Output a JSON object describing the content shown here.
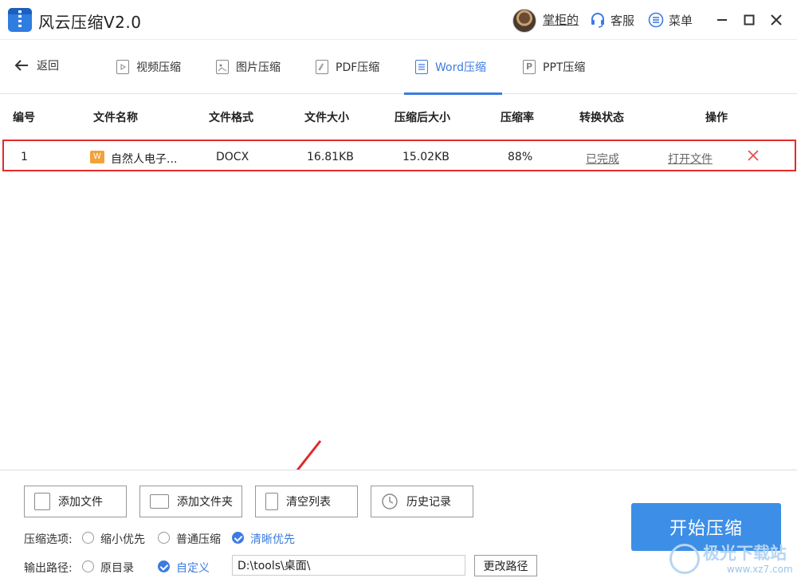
{
  "app": {
    "title": "风云压缩V2.0"
  },
  "header": {
    "user_name": "掌柜的",
    "service_label": "客服",
    "menu_label": "菜单"
  },
  "nav": {
    "back_label": "返回",
    "tabs": [
      {
        "label": "视频压缩"
      },
      {
        "label": "图片压缩"
      },
      {
        "label": "PDF压缩"
      },
      {
        "label": "Word压缩",
        "active": true
      },
      {
        "label": "PPT压缩"
      }
    ]
  },
  "table": {
    "columns": [
      "编号",
      "文件名称",
      "文件格式",
      "文件大小",
      "压缩后大小",
      "压缩率",
      "转换状态",
      "操作"
    ],
    "rows": [
      {
        "index": "1",
        "file_type_badge": "W",
        "name": "自然人电子...",
        "format": "DOCX",
        "size": "16.81KB",
        "compressed_size": "15.02KB",
        "ratio": "88%",
        "status": "已完成",
        "action": "打开文件"
      }
    ]
  },
  "toolbar": {
    "add_file": "添加文件",
    "add_folder": "添加文件夹",
    "clear_list": "清空列表",
    "history": "历史记录"
  },
  "options": {
    "compress_label": "压缩选项:",
    "compress_choices": [
      "缩小优先",
      "普通压缩",
      "清晰优先"
    ],
    "compress_selected": "清晰优先",
    "output_label": "输出路径:",
    "output_choices": [
      "原目录",
      "自定义"
    ],
    "output_selected": "自定义",
    "output_path": "D:\\tools\\桌面\\",
    "change_path": "更改路径"
  },
  "start_button": "开始压缩",
  "watermark": {
    "main": "极光下载站",
    "sub": "www.xz7.com"
  },
  "colors": {
    "accent": "#3d7be0",
    "highlight_border": "#e32a2a",
    "start_button": "#3d8ee6"
  }
}
